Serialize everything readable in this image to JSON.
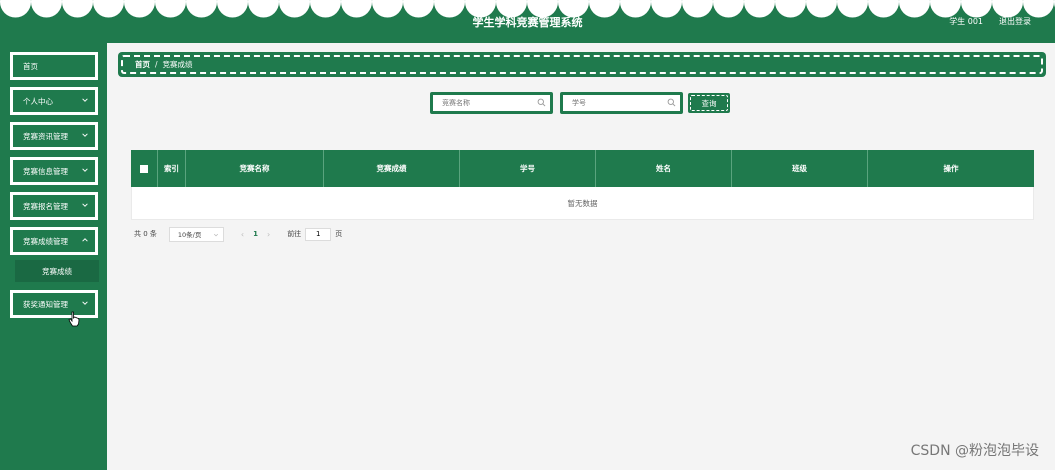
{
  "header": {
    "title": "学生学科竞赛管理系统",
    "user": "学生 001",
    "logout": "退出登录"
  },
  "sidebar": {
    "items": [
      {
        "label": "首页"
      },
      {
        "label": "个人中心"
      },
      {
        "label": "竞赛资讯管理"
      },
      {
        "label": "竞赛信息管理"
      },
      {
        "label": "竞赛报名管理"
      },
      {
        "label": "竞赛成绩管理"
      },
      {
        "label": "获奖通知管理"
      }
    ],
    "sub_item": "竞赛成绩"
  },
  "breadcrumb": {
    "home": "首页",
    "separator": "/",
    "current": "竞赛成绩"
  },
  "search": {
    "name_placeholder": "竞赛名称",
    "id_placeholder": "学号",
    "button": "查询"
  },
  "table": {
    "columns": [
      "索引",
      "竞赛名称",
      "竞赛成绩",
      "学号",
      "姓名",
      "班级",
      "操作"
    ],
    "empty_text": "暂无数据"
  },
  "pagination": {
    "total": "共 0 条",
    "page_size": "10条/页",
    "current_page": "1",
    "goto_prefix": "前往",
    "goto_value": "1",
    "goto_suffix": "页"
  },
  "watermark": "CSDN @粉泡泡毕设",
  "colors": {
    "primary": "#1f7a4d",
    "background": "#f4f4f4"
  }
}
